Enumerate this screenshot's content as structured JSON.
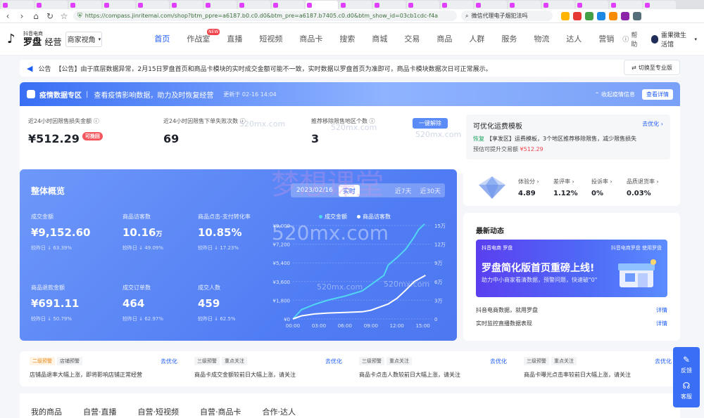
{
  "browser": {
    "tabs": [
      {
        "label": "",
        "color": "#e040fb"
      },
      {
        "label": "",
        "color": "#e040fb"
      },
      {
        "label": "",
        "color": "#e040fb"
      },
      {
        "label": "",
        "color": "#e040fb"
      },
      {
        "label": "",
        "color": "#e040fb"
      },
      {
        "label": "",
        "color": "#e040fb"
      },
      {
        "label": "",
        "color": "#e040fb"
      },
      {
        "label": "",
        "color": "#e040fb"
      },
      {
        "label": "",
        "color": "#e040fb"
      },
      {
        "label": "",
        "color": "#e040fb"
      },
      {
        "label": "",
        "color": "#e040fb"
      },
      {
        "label": "",
        "color": "#e040fb"
      },
      {
        "label": "",
        "color": "#e040fb"
      },
      {
        "label": "",
        "color": "#e040fb"
      },
      {
        "label": "",
        "color": "#e040fb"
      },
      {
        "label": "",
        "color": "#e040fb"
      },
      {
        "label": "",
        "color": "#e040fb"
      },
      {
        "label": "",
        "color": "#e040fb"
      },
      {
        "label": "",
        "color": "#e040fb"
      },
      {
        "label": "",
        "color": "#e040fb"
      }
    ],
    "url": "https://compass.jinritemai.com/shop?btm_ppre=a6187.b0.c0.d0&btm_pre=a6187.b7405.c0.d0&btm_show_id=03cb1cdc-f4a",
    "search": "微信代理电子烟犯法吗"
  },
  "topnav": {
    "logo_small": "抖音电商",
    "logo_main": "罗盘",
    "logo_sub": "经营",
    "view_select": "商家视角",
    "menu": [
      "首页",
      "作战室",
      "直播",
      "短视频",
      "商品卡",
      "搜索",
      "商城",
      "交易",
      "商品",
      "人群",
      "服务",
      "物流",
      "达人",
      "营销"
    ],
    "new_badge": "NEW",
    "help": "帮助",
    "user": "雷果微生活馆"
  },
  "notice": {
    "label": "公告",
    "text": "【公告】由于底层数据异常，2月15日罗盘首页和商品卡模块的实时成交金额可能不一致，实时数据以罗盘首页为准即可，商品卡模块数据次日可正常展示。",
    "switch_button": "切换至专业版"
  },
  "epidemic": {
    "title": "疫情数据专区",
    "subtitle": "查看疫情影响数据，助力及时恢复经营",
    "updated": "更新于 02-16 14:04",
    "collapse": "收起疫情信息",
    "detail_button": "查看详情",
    "kpis": [
      {
        "label": "近24小时因限售损失金额",
        "value": "¥512.29",
        "badge": "可挽回"
      },
      {
        "label": "近24小时因限售下单失败次数",
        "value": "69",
        "badge": ""
      },
      {
        "label": "推荐移除限售地区个数",
        "value": "3",
        "badge": ""
      }
    ],
    "unlock_button": "一键解除",
    "fee": {
      "title": "可优化运费模板",
      "go": "去优化",
      "tag": "恢复",
      "line": "【享发区】运费模板，3个地区推荐移除限售，减少限售损失",
      "line2_prefix": "预估可提升交易额",
      "amount": "¥512.29"
    }
  },
  "overview": {
    "title": "整体概览",
    "date": "2023/02/16",
    "realtime": "实时",
    "options": [
      "近7天",
      "近30天"
    ],
    "metrics": [
      {
        "label": "成交金额",
        "value": "¥9,152.60",
        "unit": "",
        "compare": "较昨日 ↓ 63.39%"
      },
      {
        "label": "商品访客数",
        "value": "10.16",
        "unit": "万",
        "compare": "较昨日 ↓ 49.09%"
      },
      {
        "label": "商品点击-支付转化率",
        "value": "10.85%",
        "unit": "",
        "compare": "较昨日 ↓ 17.23%"
      },
      {
        "label": "商品退款金额",
        "value": "¥691.11",
        "unit": "",
        "compare": "较昨日 ↓ 50.79%"
      },
      {
        "label": "成交订单数",
        "value": "464",
        "unit": "",
        "compare": "较昨日 ↓ 62.97%"
      },
      {
        "label": "成交人数",
        "value": "459",
        "unit": "",
        "compare": "较昨日 ↓ 62.5%"
      }
    ]
  },
  "chart_data": {
    "type": "line",
    "x": [
      "00:00",
      "03:00",
      "06:00",
      "09:00",
      "12:00",
      "15:00"
    ],
    "series": [
      {
        "name": "成交金额",
        "axis": "left",
        "color": "#52d6f2",
        "points": [
          [
            0,
            0
          ],
          [
            1,
            900
          ],
          [
            2.5,
            1400
          ],
          [
            4,
            1800
          ],
          [
            6,
            2200
          ],
          [
            8,
            2700
          ],
          [
            9.5,
            3600
          ],
          [
            10.5,
            4200
          ],
          [
            11,
            5200
          ],
          [
            12,
            5900
          ],
          [
            13,
            6700
          ],
          [
            14,
            7900
          ],
          [
            14.5,
            8600
          ],
          [
            15.2,
            9150
          ]
        ]
      },
      {
        "name": "商品访客数",
        "axis": "right",
        "color": "#ffffff",
        "points": [
          [
            0,
            0
          ],
          [
            1,
            0.5
          ],
          [
            2.5,
            0.8
          ],
          [
            4,
            0.95
          ],
          [
            6,
            1.05
          ],
          [
            8,
            1.15
          ],
          [
            9,
            1.4
          ],
          [
            10,
            1.9
          ],
          [
            11,
            2.4
          ],
          [
            12,
            3.3
          ],
          [
            13,
            4.6
          ],
          [
            14,
            6.0
          ],
          [
            15.3,
            7.0
          ]
        ]
      }
    ],
    "y_left": {
      "ticks": [
        "¥0",
        "¥1,800",
        "¥3,600",
        "¥5,400",
        "¥7,200",
        "¥9,000"
      ],
      "range": [
        0,
        9000
      ]
    },
    "y_right": {
      "ticks": [
        "0",
        "3万",
        "6万",
        "9万",
        "12万",
        "15万"
      ],
      "range": [
        0,
        15
      ]
    },
    "x_range": [
      0,
      16
    ]
  },
  "scores": [
    {
      "label": "体验分",
      "value": "4.89"
    },
    {
      "label": "差评率",
      "value": "1.12%"
    },
    {
      "label": "投诉率",
      "value": "0%"
    },
    {
      "label": "品质退货率",
      "value": "0.03%"
    }
  ],
  "news": {
    "title": "最新动态",
    "banner_left": "抖音电商 罗盘",
    "banner_right": "抖音电商罗盘 使用罗盘",
    "banner_title": "罗盘简化版首页重磅上线!",
    "banner_sub": "助力中小商家看清数据，预警问题，快速破\"0\"",
    "items": [
      {
        "text": "抖音电商数据，就用罗盘",
        "link": "详情"
      },
      {
        "text": "实时监控直播数据表现",
        "link": "详情"
      }
    ]
  },
  "alerts": [
    {
      "level": "二级预警",
      "type": "店铺预警",
      "opt": "去优化",
      "desc": "店铺品退率大幅上涨，即将影响店铺正常经营",
      "hot": true
    },
    {
      "level": "三级预警",
      "type": "重点关注",
      "opt": "去优化",
      "desc": "商品卡成交金额较前日大幅上涨，请关注",
      "hot": false
    },
    {
      "level": "三级预警",
      "type": "重点关注",
      "opt": "去优化",
      "desc": "商品卡点击人数较前日大幅上涨，请关注",
      "hot": false
    },
    {
      "level": "三级预警",
      "type": "重点关注",
      "opt": "去优化",
      "desc": "商品卡曝光点击率较前日大幅上涨，请关注",
      "hot": false
    }
  ],
  "bottom_tabs": [
    "我的商品",
    "自营·直播",
    "自营·短视频",
    "自营·商品卡",
    "合作·达人"
  ],
  "float": {
    "feedback": "反馈",
    "service": "客服"
  },
  "watermark": {
    "text1": "梦想课堂",
    "text2": "520mx.com"
  }
}
